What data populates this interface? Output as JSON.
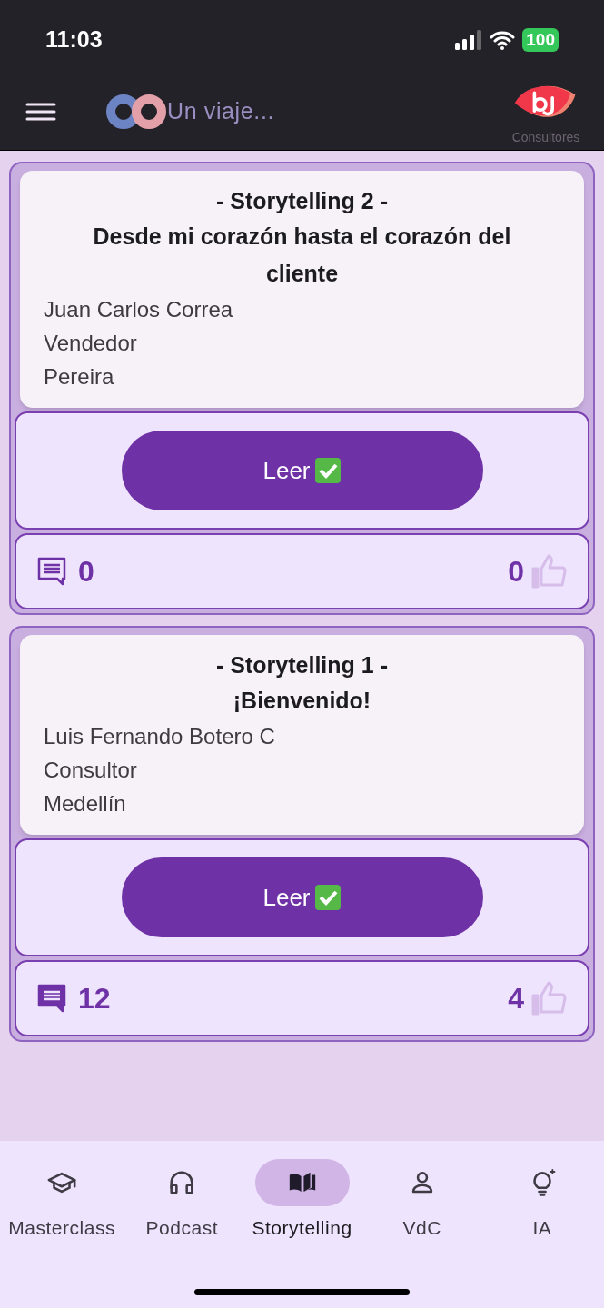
{
  "status_bar": {
    "time": "11:03",
    "battery": "100"
  },
  "header": {
    "app_title": "Un viaje...",
    "logo_caption": "Consultores"
  },
  "stories": [
    {
      "title": "- Storytelling 2 -",
      "subtitle": "Desde mi corazón hasta el corazón del cliente",
      "author": "Juan Carlos Correa",
      "role": "Vendedor",
      "city": "Pereira",
      "button": "Leer",
      "comments": "0",
      "likes": "0"
    },
    {
      "title": "- Storytelling 1 -",
      "subtitle": "¡Bienvenido!",
      "author": "Luis Fernando Botero C",
      "role": "Consultor",
      "city": "Medellín",
      "button": "Leer",
      "comments": "12",
      "likes": "4"
    }
  ],
  "nav": [
    {
      "kind": "cap",
      "label": "Masterclass",
      "selected": false
    },
    {
      "kind": "headphones",
      "label": "Podcast",
      "selected": false
    },
    {
      "kind": "book",
      "label": "Storytelling",
      "selected": true
    },
    {
      "kind": "person",
      "label": "VdC",
      "selected": false
    },
    {
      "kind": "bulb",
      "label": "IA",
      "selected": false
    }
  ]
}
